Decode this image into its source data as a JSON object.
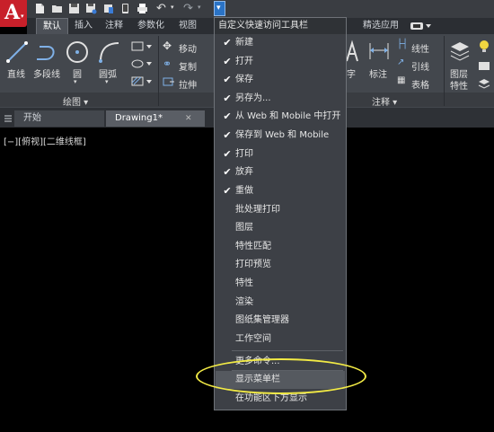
{
  "qat": {
    "app_menu_caret": "▾",
    "undo_glyph": "↶",
    "redo_glyph": "↷",
    "dropdown_glyph": "▾"
  },
  "ribbon_tabs": [
    "默认",
    "插入",
    "注释",
    "参数化",
    "视图",
    "精选应用"
  ],
  "ribbon": {
    "draw_tools": [
      {
        "label": "直线",
        "icon": "line-icon"
      },
      {
        "label": "多段线",
        "icon": "polyline-icon"
      },
      {
        "label": "圆",
        "icon": "circle-icon"
      },
      {
        "label": "圆弧",
        "icon": "arc-icon"
      }
    ],
    "modify_tools": [
      "移动",
      "复制",
      "拉伸"
    ],
    "annotation_tools": [
      "字",
      "标注",
      "线性",
      "引线",
      "表格"
    ],
    "layers": {
      "label_line1": "图层",
      "label_line2": "特性"
    },
    "panel_titles": {
      "draw": "绘图 ▾",
      "annotation": "注释 ▾"
    }
  },
  "doc_tabs": [
    {
      "label": "开始",
      "active": false
    },
    {
      "label": "Drawing1*",
      "active": true,
      "close": "✕"
    }
  ],
  "viewport_label": "[−][俯视][二维线框]",
  "menu": {
    "title": "自定义快速访问工具栏",
    "items": [
      {
        "label": "新建",
        "checked": true
      },
      {
        "label": "打开",
        "checked": true
      },
      {
        "label": "保存",
        "checked": true
      },
      {
        "label": "另存为...",
        "checked": true
      },
      {
        "label": "从 Web 和 Mobile 中打开",
        "checked": true
      },
      {
        "label": "保存到 Web 和 Mobile",
        "checked": true
      },
      {
        "label": "打印",
        "checked": true
      },
      {
        "label": "放弃",
        "checked": true
      },
      {
        "label": "重做",
        "checked": true
      },
      {
        "label": "批处理打印",
        "checked": false
      },
      {
        "label": "图层",
        "checked": false
      },
      {
        "label": "特性匹配",
        "checked": false
      },
      {
        "label": "打印预览",
        "checked": false
      },
      {
        "label": "特性",
        "checked": false
      },
      {
        "label": "渲染",
        "checked": false
      },
      {
        "label": "图纸集管理器",
        "checked": false
      },
      {
        "label": "工作空间",
        "checked": false
      },
      {
        "label": "更多命令...",
        "checked": false
      },
      {
        "label": "显示菜单栏",
        "checked": false
      },
      {
        "label": "在功能区下方显示",
        "checked": false
      }
    ],
    "check_glyph": "✔"
  },
  "colors": {
    "highlight": "#f2ea45",
    "app_red": "#c8202a",
    "qat_blue": "#2a73c6"
  }
}
